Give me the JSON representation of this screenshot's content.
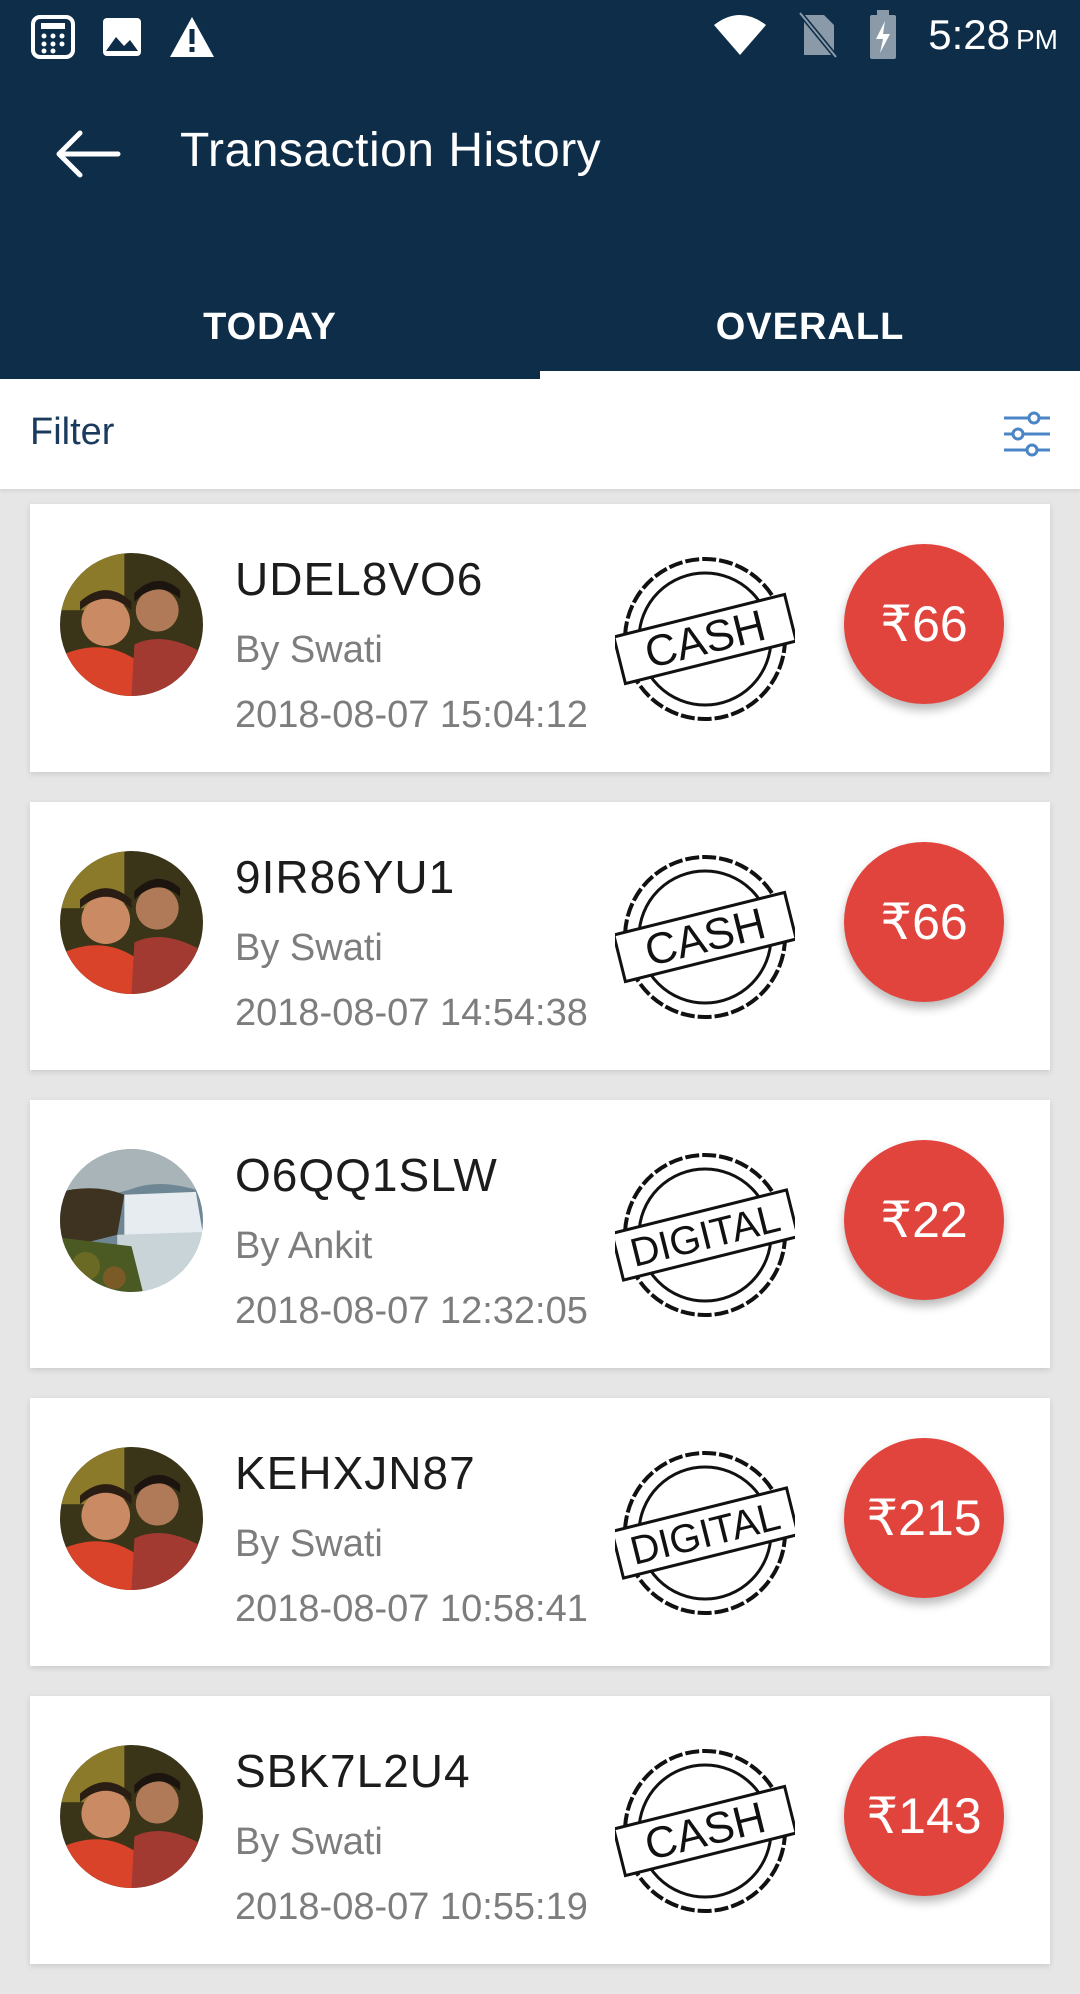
{
  "status_bar": {
    "time": "5:28",
    "ampm": "PM",
    "icons": [
      "calculator-icon",
      "image-icon",
      "warning-icon",
      "wifi-icon",
      "no-sim-icon",
      "battery-charging-icon"
    ]
  },
  "header": {
    "title": "Transaction History",
    "back_icon": "back-arrow-icon",
    "background": "#0d2d48"
  },
  "tabs": [
    {
      "label": "TODAY",
      "active": false
    },
    {
      "label": "OVERALL",
      "active": true
    }
  ],
  "filter": {
    "label": "Filter",
    "icon": "filter-sliders-icon"
  },
  "transactions": [
    {
      "id": "UDEL8VO6",
      "by": "By Swati",
      "date": "2018-08-07 15:04:12",
      "mode": "CASH",
      "amount": "₹66",
      "avatar": "couple-photo"
    },
    {
      "id": "9IR86YU1",
      "by": "By Swati",
      "date": "2018-08-07 14:54:38",
      "mode": "CASH",
      "amount": "₹66",
      "avatar": "couple-photo"
    },
    {
      "id": "O6QQ1SLW",
      "by": "By Ankit",
      "date": "2018-08-07 12:32:05",
      "mode": "DIGITAL",
      "amount": "₹22",
      "avatar": "waterfall-photo"
    },
    {
      "id": "KEHXJN87",
      "by": "By Swati",
      "date": "2018-08-07 10:58:41",
      "mode": "DIGITAL",
      "amount": "₹215",
      "avatar": "couple-photo"
    },
    {
      "id": "SBK7L2U4",
      "by": "By Swati",
      "date": "2018-08-07 10:55:19",
      "mode": "CASH",
      "amount": "₹143",
      "avatar": "couple-photo"
    }
  ],
  "colors": {
    "amount_badge": "#e0443c",
    "primary_dark": "#0d2d48",
    "filter_text": "#1a3b5d"
  }
}
